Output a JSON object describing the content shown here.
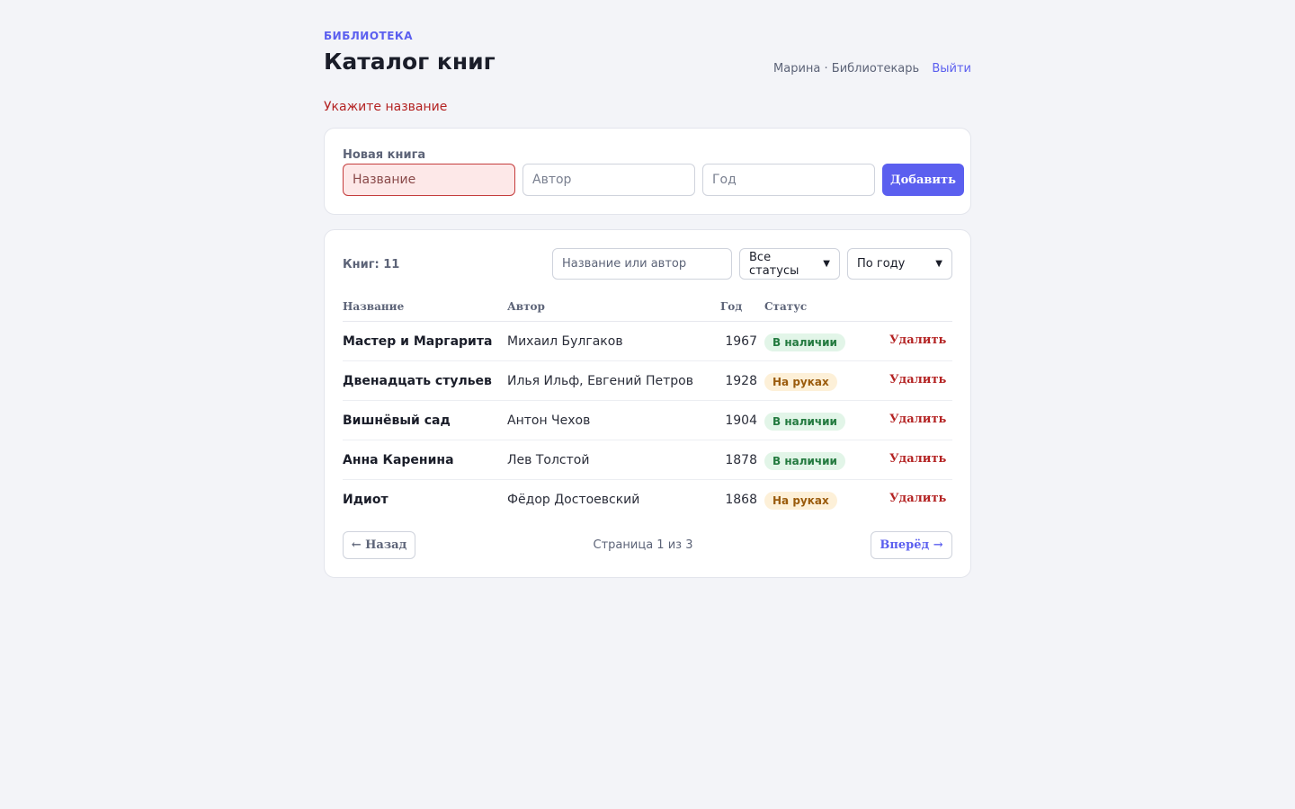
{
  "header": {
    "brand": "БИБЛИОТЕКА",
    "title": "Каталог книг",
    "user": "Марина · Библиотекарь",
    "logout": "Выйти"
  },
  "error": "Укажите название",
  "new_book": {
    "label": "Новая книга",
    "title_placeholder": "Название",
    "author_placeholder": "Автор",
    "year_placeholder": "Год",
    "add_label": "Добавить"
  },
  "list": {
    "count": "Книг: 11",
    "search_placeholder": "Название или автор",
    "status_filter": "Все статусы",
    "sort": "По году",
    "columns": {
      "title": "Название",
      "author": "Автор",
      "year": "Год",
      "status": "Статус"
    },
    "rows": [
      {
        "title": "Мастер и Маргарита",
        "author": "Михаил Булгаков",
        "year": "1967",
        "status": "В наличии",
        "status_kind": "available",
        "delete": "Удалить"
      },
      {
        "title": "Двенадцать стульев",
        "author": "Илья Ильф, Евгений Петров",
        "year": "1928",
        "status": "На руках",
        "status_kind": "borrowed",
        "delete": "Удалить"
      },
      {
        "title": "Вишнёвый сад",
        "author": "Антон Чехов",
        "year": "1904",
        "status": "В наличии",
        "status_kind": "available",
        "delete": "Удалить"
      },
      {
        "title": "Анна Каренина",
        "author": "Лев Толстой",
        "year": "1878",
        "status": "В наличии",
        "status_kind": "available",
        "delete": "Удалить"
      },
      {
        "title": "Идиот",
        "author": "Фёдор Достоевский",
        "year": "1868",
        "status": "На руках",
        "status_kind": "borrowed",
        "delete": "Удалить"
      }
    ],
    "pagination": {
      "prev": "← Назад",
      "info": "Страница 1 из 3",
      "next": "Вперёд →"
    }
  },
  "colors": {
    "accent": "#5b5fef",
    "error": "#b42323",
    "available_bg": "#e2f5e8",
    "borrowed_bg": "#fdf0d8"
  },
  "icons": {
    "select_chevron": "chevron-down-icon"
  }
}
